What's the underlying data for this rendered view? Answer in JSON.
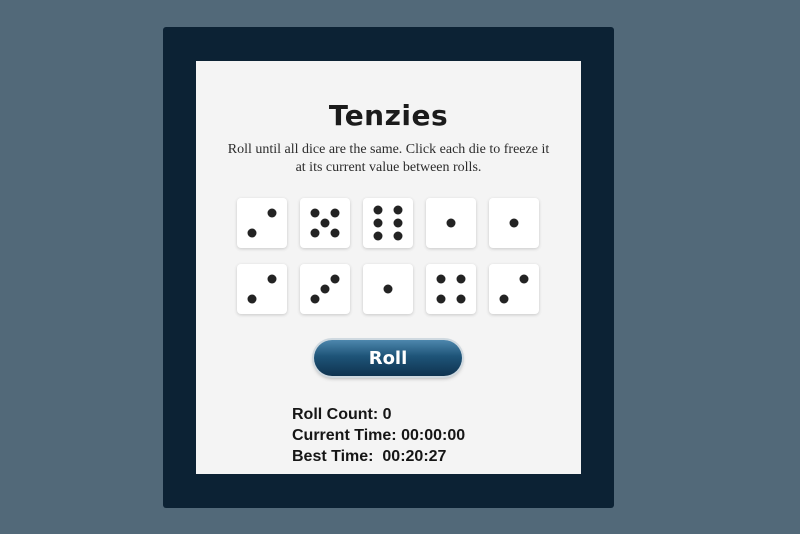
{
  "game": {
    "title": "Tenzies",
    "instructions": "Roll until all dice are the same. Click each die to freeze it at its current value between rolls.",
    "dice": [
      2,
      5,
      6,
      1,
      1,
      2,
      3,
      1,
      4,
      2
    ],
    "roll_label": "Roll",
    "stats": {
      "roll_count_label": "Roll Count:",
      "roll_count": "0",
      "current_time_label": "Current Time:",
      "current_time": "00:00:00",
      "best_time_label": "Best Time:",
      "best_time": "00:20:27"
    }
  },
  "colors": {
    "page_background": "#526979",
    "frame": "#0c2234",
    "panel": "#f4f4f4",
    "button": "#1e5478"
  }
}
